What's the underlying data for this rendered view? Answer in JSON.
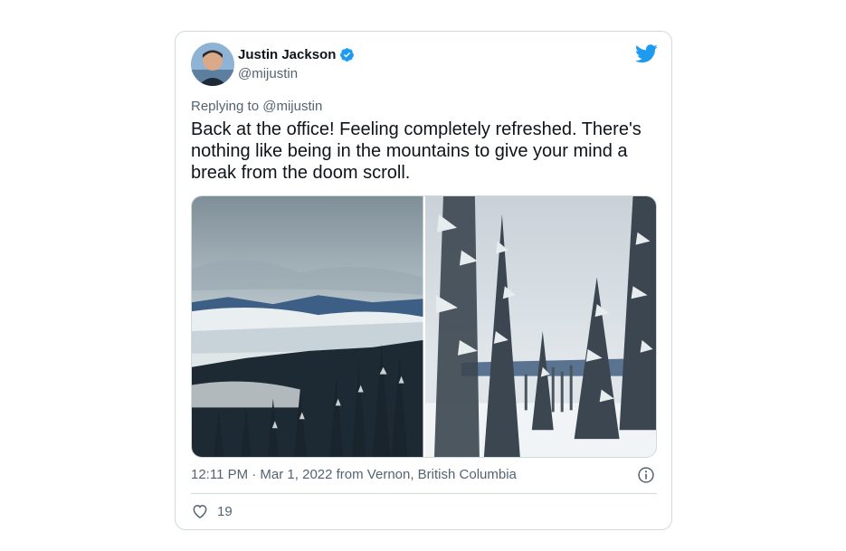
{
  "author": {
    "name": "Justin Jackson",
    "handle": "@mijustin",
    "verified": true
  },
  "reply": {
    "prefix": "Replying to ",
    "mention": "@mijustin"
  },
  "tweet": {
    "text": "Back at the office! Feeling completely refreshed. There's nothing like being in the mountains to give your mind a break from the doom scroll."
  },
  "meta": {
    "timestamp": "12:11 PM · Mar 1, 2022 from Vernon, British Columbia"
  },
  "engagement": {
    "likes": "19"
  },
  "icons": {
    "brand": "twitter-bird-icon",
    "verified": "verified-badge-icon",
    "info": "info-icon",
    "like": "heart-icon"
  },
  "colors": {
    "brand_blue": "#1d9bf0",
    "text_primary": "#0f1419",
    "text_secondary": "#536471",
    "border": "#cfd9de"
  }
}
